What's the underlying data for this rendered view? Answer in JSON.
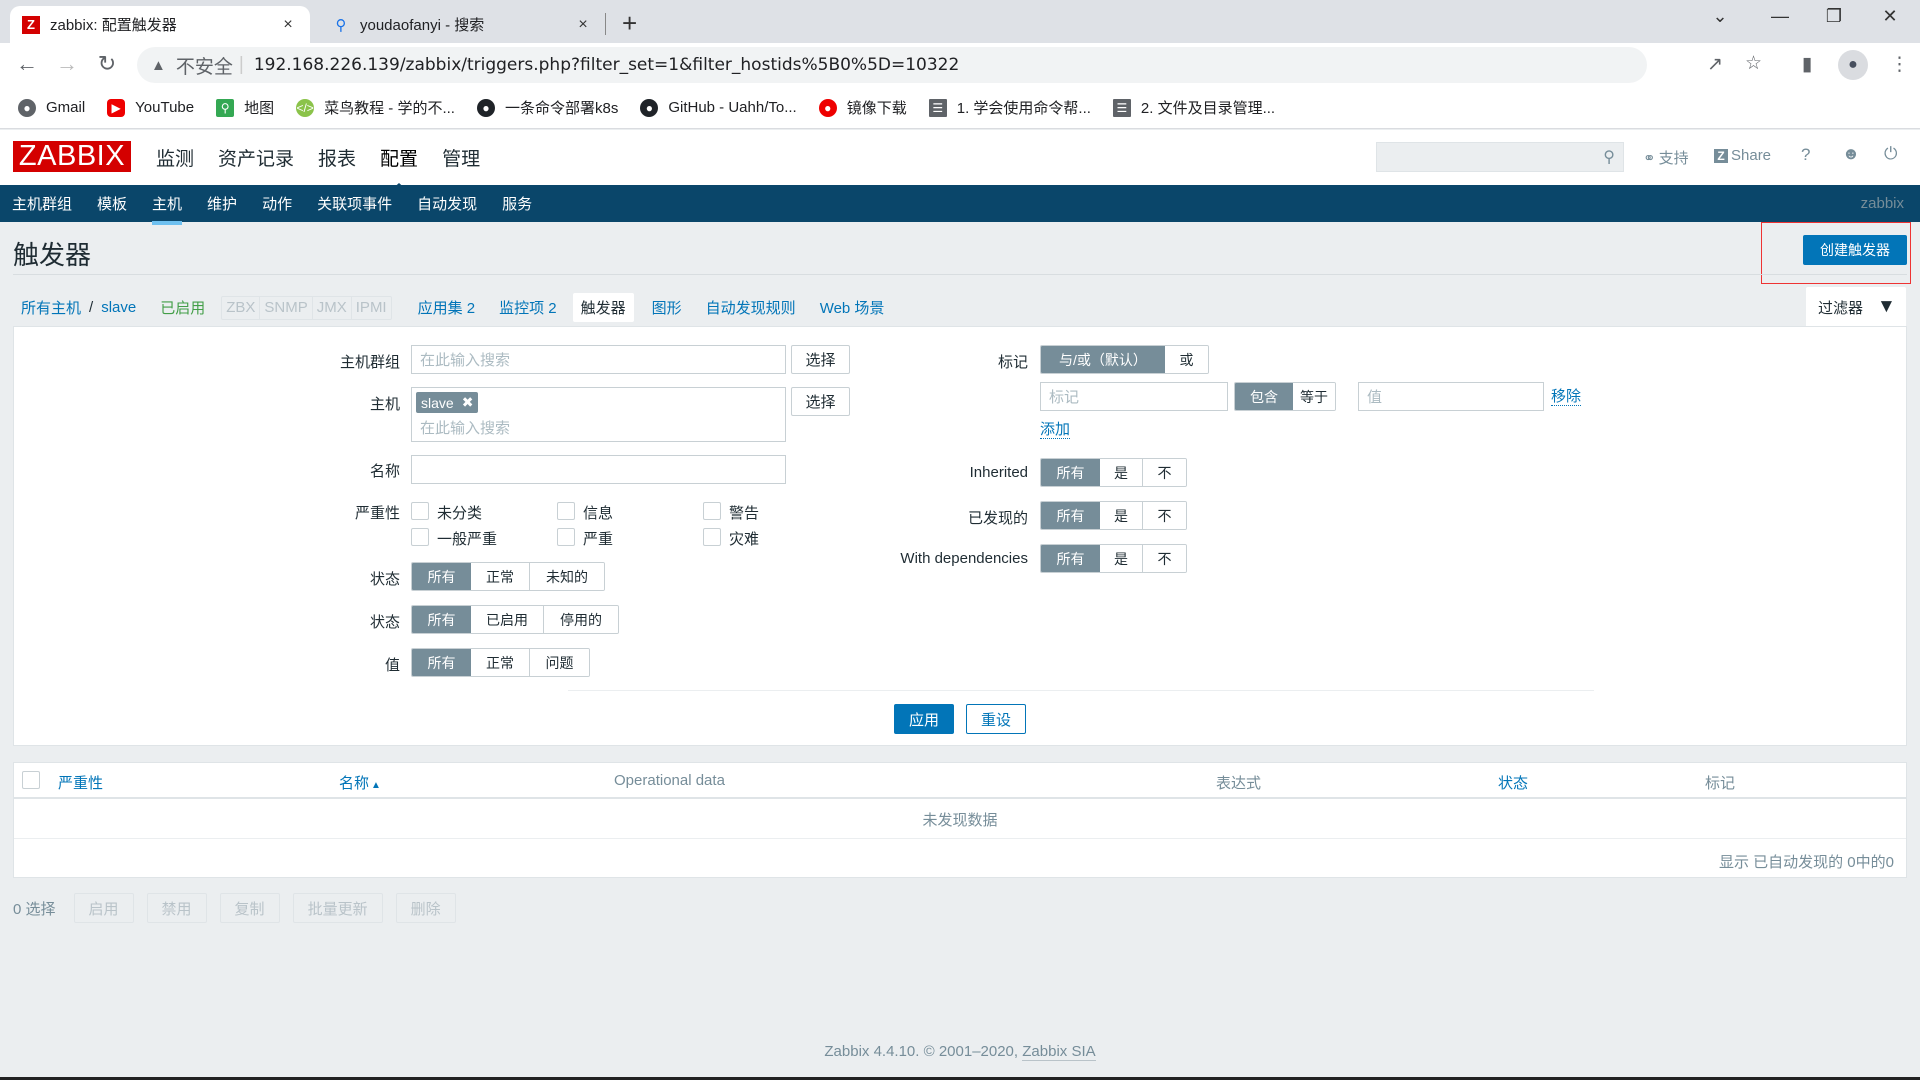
{
  "browser": {
    "tabs": [
      {
        "title": "zabbix: 配置触发器",
        "favicon": "zabbix-z-icon",
        "active": true
      },
      {
        "title": "youdaofanyi - 搜索",
        "favicon": "search-icon",
        "active": false
      }
    ],
    "new_tab": "+",
    "close": "×",
    "security_label": "不安全",
    "url": "192.168.226.139/zabbix/triggers.php?filter_set=1&filter_hostids%5B0%5D=10322",
    "bookmarks": [
      {
        "label": "Gmail",
        "icon": "globe-icon"
      },
      {
        "label": "YouTube",
        "icon": "youtube-icon"
      },
      {
        "label": "地图",
        "icon": "maps-icon"
      },
      {
        "label": "菜鸟教程 - 学的不...",
        "icon": "runoob-icon"
      },
      {
        "label": "一条命令部署k8s",
        "icon": "github-icon"
      },
      {
        "label": "GitHub - Uahh/To...",
        "icon": "github-icon"
      },
      {
        "label": "镜像下载",
        "icon": "redhat-icon"
      },
      {
        "label": "1. 学会使用命令帮...",
        "icon": "book-icon"
      },
      {
        "label": "2. 文件及目录管理...",
        "icon": "book-icon"
      }
    ]
  },
  "header": {
    "logo": "ZABBIX",
    "main_menu": [
      "监测",
      "资产记录",
      "报表",
      "配置",
      "管理"
    ],
    "main_menu_selected": "配置",
    "search_placeholder": "",
    "support": "支持",
    "share": "Share",
    "help": "?",
    "sub_menu": [
      "主机群组",
      "模板",
      "主机",
      "维护",
      "动作",
      "关联项事件",
      "自动发现",
      "服务"
    ],
    "sub_menu_selected": "主机",
    "username": "zabbix"
  },
  "page": {
    "title": "触发器",
    "create_button": "创建触发器",
    "breadcrumb": {
      "all_hosts": "所有主机",
      "separator": "/",
      "host": "slave",
      "status": "已启用",
      "availability": [
        "ZBX",
        "SNMP",
        "JMX",
        "IPMI"
      ],
      "tabs": [
        {
          "label": "应用集 2"
        },
        {
          "label": "监控项 2"
        },
        {
          "label": "触发器",
          "current": true
        },
        {
          "label": "图形"
        },
        {
          "label": "自动发现规则"
        },
        {
          "label": "Web 场景"
        }
      ]
    },
    "filter_tab": "过滤器"
  },
  "filter": {
    "host_groups": {
      "label": "主机群组",
      "placeholder": "在此输入搜索",
      "select": "选择"
    },
    "hosts": {
      "label": "主机",
      "selected": [
        "slave"
      ],
      "placeholder": "在此输入搜索",
      "select": "选择"
    },
    "name": {
      "label": "名称",
      "value": ""
    },
    "severity": {
      "label": "严重性",
      "options": [
        {
          "label": "未分类",
          "checked": false
        },
        {
          "label": "信息",
          "checked": false
        },
        {
          "label": "警告",
          "checked": false
        },
        {
          "label": "一般严重",
          "checked": false
        },
        {
          "label": "严重",
          "checked": false
        },
        {
          "label": "灾难",
          "checked": false
        }
      ]
    },
    "state": {
      "label": "状态",
      "options": [
        "所有",
        "正常",
        "未知的"
      ],
      "selected": "所有"
    },
    "status": {
      "label": "状态",
      "options": [
        "所有",
        "已启用",
        "停用的"
      ],
      "selected": "所有"
    },
    "value": {
      "label": "值",
      "options": [
        "所有",
        "正常",
        "问题"
      ],
      "selected": "所有"
    },
    "tags": {
      "label": "标记",
      "operator_options": [
        "与/或（默认）",
        "或"
      ],
      "operator_selected": "与/或（默认）",
      "tag_placeholder": "标记",
      "match_options": [
        "包含",
        "等于"
      ],
      "match_selected": "包含",
      "value_placeholder": "值",
      "remove": "移除",
      "add": "添加"
    },
    "inherited": {
      "label": "Inherited",
      "options": [
        "所有",
        "是",
        "不"
      ],
      "selected": "所有"
    },
    "discovered": {
      "label": "已发现的",
      "options": [
        "所有",
        "是",
        "不"
      ],
      "selected": "所有"
    },
    "with_dependencies": {
      "label": "With dependencies",
      "options": [
        "所有",
        "是",
        "不"
      ],
      "selected": "所有"
    },
    "apply": "应用",
    "reset": "重设"
  },
  "table": {
    "columns": [
      {
        "label": "严重性",
        "sortable": true
      },
      {
        "label": "名称",
        "sortable": true,
        "sort": "▲"
      },
      {
        "label": "Operational data",
        "sortable": false
      },
      {
        "label": "表达式",
        "sortable": false
      },
      {
        "label": "状态",
        "sortable": true
      },
      {
        "label": "标记",
        "sortable": false
      }
    ],
    "empty_text": "未发现数据",
    "paging": "显示 已自动发现的 0中的0"
  },
  "mass_actions": {
    "selected_count": "0 选择",
    "buttons": [
      "启用",
      "禁用",
      "复制",
      "批量更新",
      "删除"
    ]
  },
  "footer": {
    "text": "Zabbix 4.4.10. © 2001–2020, ",
    "link": "Zabbix SIA"
  },
  "colors": {
    "brand_red": "#d40000",
    "nav_blue": "#0a466a",
    "link_blue": "#0275b8",
    "segment_selected": "#768d99",
    "enabled_green": "#429e47"
  }
}
